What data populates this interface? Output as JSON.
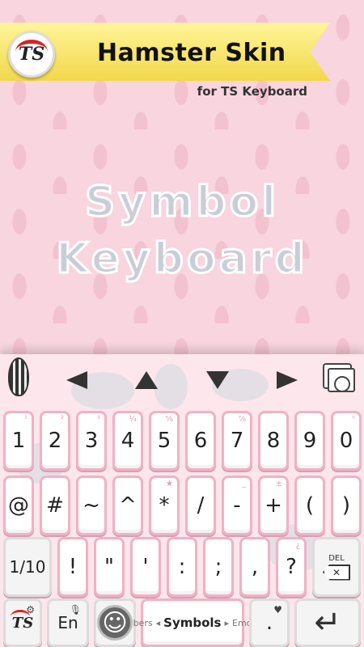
{
  "promo": {
    "title": "Hamster Skin",
    "subtitle": "for TS Keyboard",
    "logo_text": "TS",
    "hero_line1": "Symbol",
    "hero_line2": "Keyboard"
  },
  "keyboard": {
    "toolbar_icons": [
      "seed-icon",
      "arrow-left-icon",
      "arrow-up-icon",
      "arrow-down-icon",
      "arrow-right-icon",
      "gallery-icon"
    ],
    "row1": [
      {
        "label": "1",
        "hint": "¹"
      },
      {
        "label": "2",
        "hint": "²"
      },
      {
        "label": "3",
        "hint": "³"
      },
      {
        "label": "4",
        "hint": "¼"
      },
      {
        "label": "5",
        "hint": "⅝"
      },
      {
        "label": "6",
        "hint": ""
      },
      {
        "label": "7",
        "hint": "⅞"
      },
      {
        "label": "8",
        "hint": ""
      },
      {
        "label": "9",
        "hint": ""
      },
      {
        "label": "0",
        "hint": "ⁿ"
      }
    ],
    "row2": [
      {
        "label": "@"
      },
      {
        "label": "#"
      },
      {
        "label": "~"
      },
      {
        "label": "^"
      },
      {
        "label": "*",
        "hint": "★"
      },
      {
        "label": "/"
      },
      {
        "label": "-",
        "hint": "_"
      },
      {
        "label": "+",
        "hint": "±"
      },
      {
        "label": "("
      },
      {
        "label": ")"
      }
    ],
    "row3": [
      {
        "label": "1/10"
      },
      {
        "label": "!"
      },
      {
        "label": "\""
      },
      {
        "label": "'"
      },
      {
        "label": ":"
      },
      {
        "label": ";"
      },
      {
        "label": ","
      },
      {
        "label": "?",
        "hint": "¿"
      }
    ],
    "del_label": "DEL",
    "bottom": {
      "ts_label": "TS",
      "lang_label": "En",
      "emoji_label": "☺",
      "symbols_left": "bers",
      "symbols_main": "Symbols",
      "symbols_right": "Emo",
      "heart_label": "♥",
      "dot_label": ".",
      "enter_label": "↵"
    }
  },
  "colors": {
    "background": "#f8d5df",
    "banner": "#f6e470",
    "key_border": "#efb2c6"
  }
}
